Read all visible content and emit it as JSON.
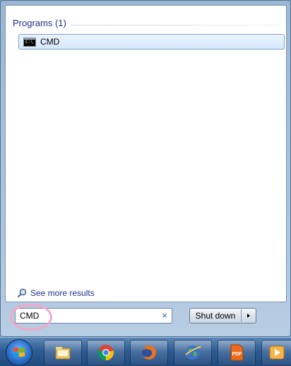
{
  "results": {
    "section_title": "Programs (1)",
    "items": [
      {
        "label": "CMD",
        "icon": "cmd-icon"
      }
    ],
    "see_more": "See more results"
  },
  "search": {
    "value": "CMD",
    "clear_icon": "close-icon",
    "clear_glyph": "×"
  },
  "shutdown": {
    "label": "Shut down"
  },
  "taskbar": {
    "items": [
      {
        "name": "start-orb",
        "icon": "windows-logo-icon"
      },
      {
        "name": "file-explorer",
        "icon": "folder-icon"
      },
      {
        "name": "google-chrome",
        "icon": "chrome-icon"
      },
      {
        "name": "mozilla-firefox",
        "icon": "firefox-icon"
      },
      {
        "name": "internet-globe",
        "icon": "globe-icon"
      },
      {
        "name": "pdf-reader",
        "icon": "pdf-icon",
        "badge": "PDF"
      },
      {
        "name": "media-player",
        "icon": "play-icon"
      }
    ]
  },
  "colors": {
    "accent_blue": "#1e3287",
    "highlight_ring": "#f4a6c9",
    "taskbar": "#2e5c93"
  }
}
